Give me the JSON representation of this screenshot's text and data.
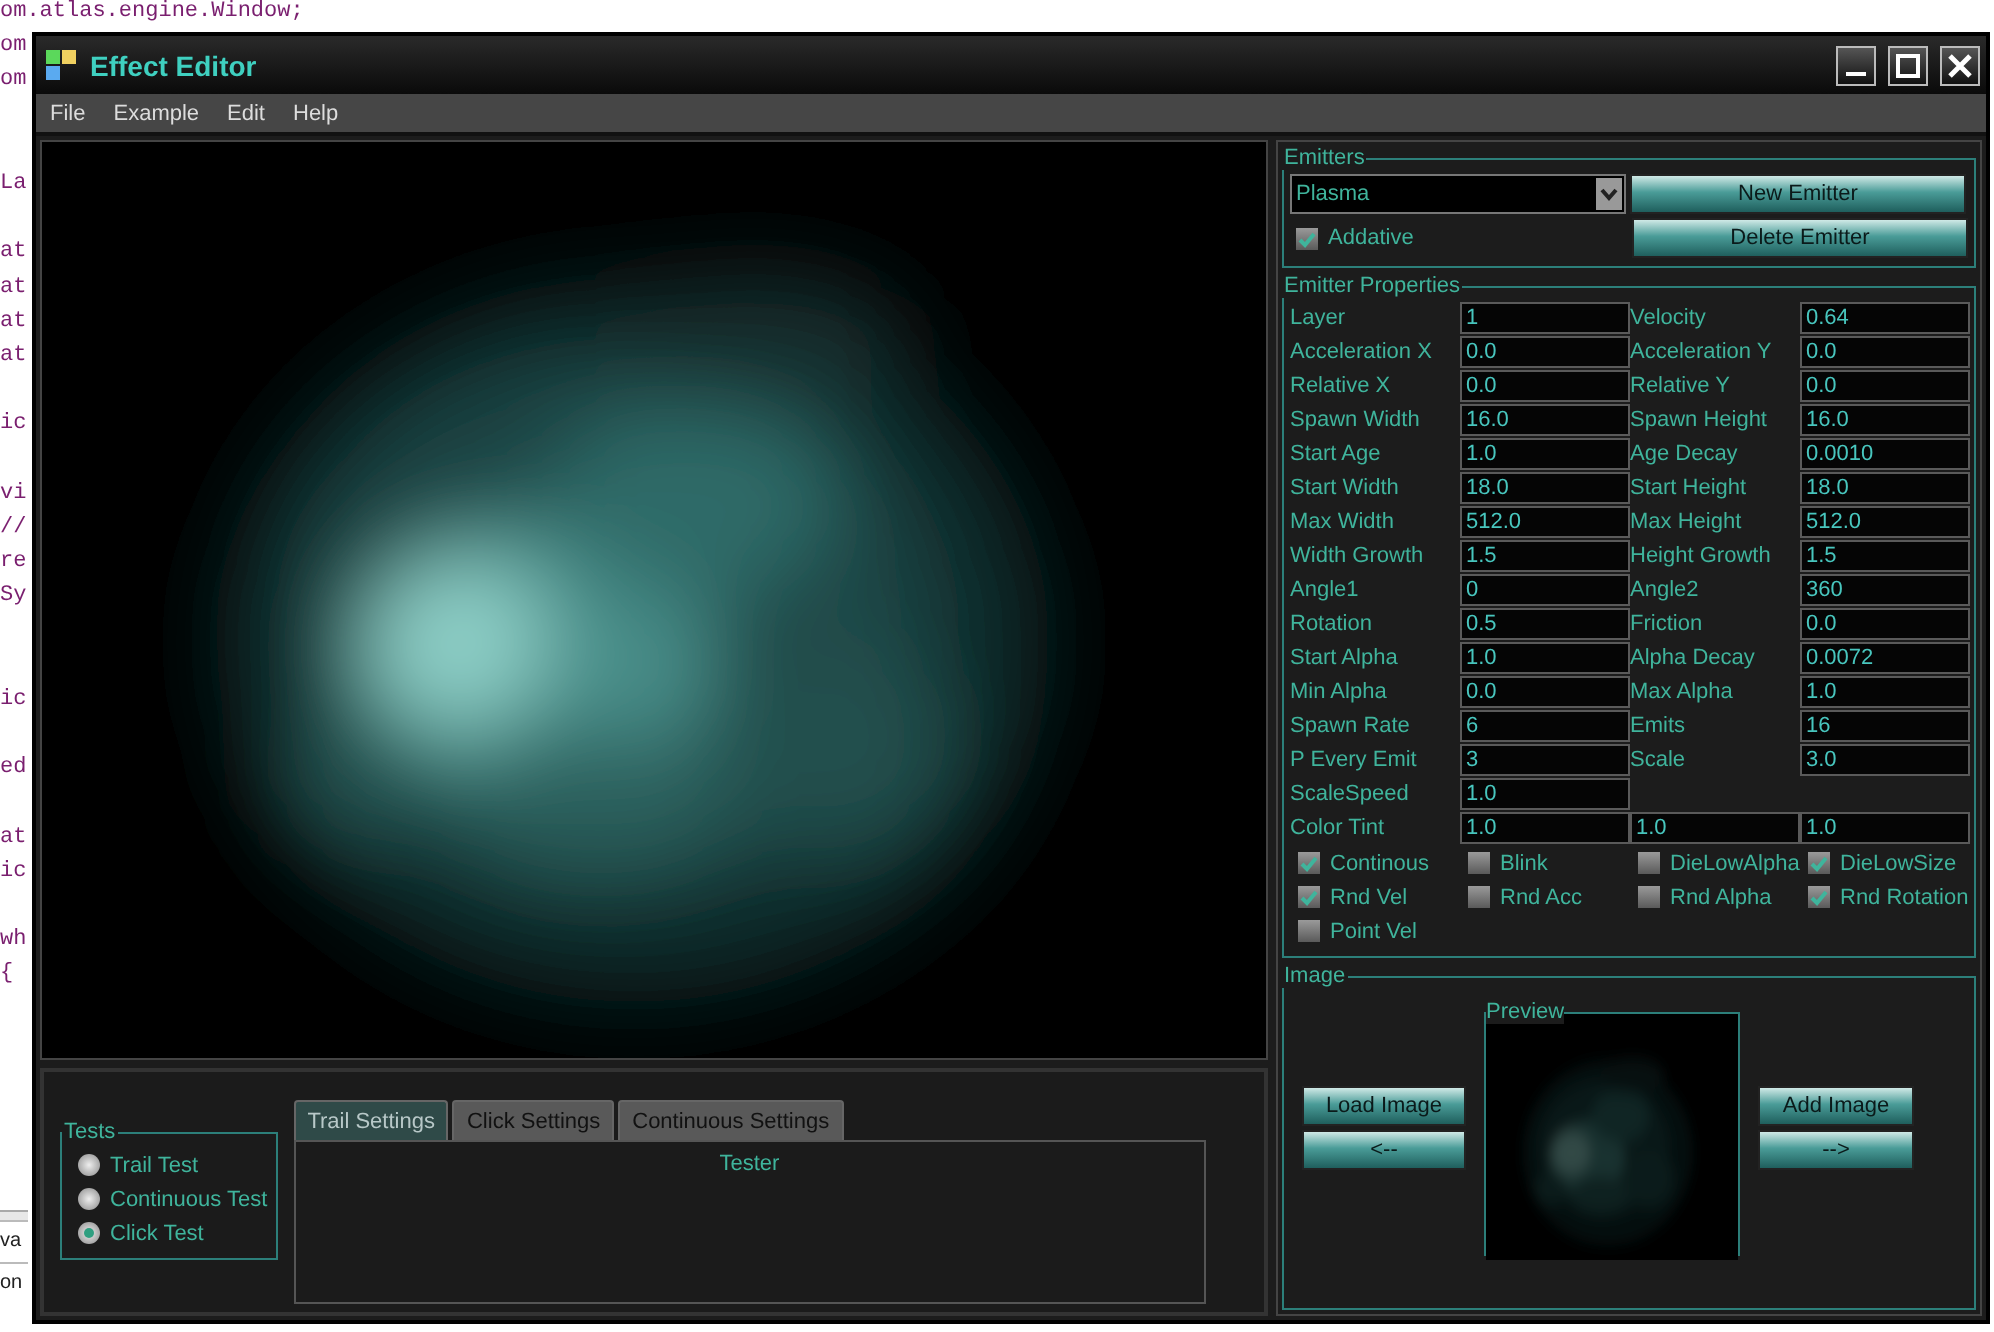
{
  "code_lines": [
    {
      "kind": "text",
      "text": "om.atlas.engine.Window;"
    },
    {
      "kind": "text",
      "text": "om"
    },
    {
      "kind": "text",
      "text": "om"
    },
    {
      "kind": "blank"
    },
    {
      "kind": "blank"
    },
    {
      "kind": "text",
      "text": "La"
    },
    {
      "kind": "blank"
    },
    {
      "kind": "text",
      "text": "at"
    },
    {
      "kind": "text",
      "text": "at"
    },
    {
      "kind": "text",
      "text": "at"
    },
    {
      "kind": "text",
      "text": "at"
    },
    {
      "kind": "blank"
    },
    {
      "kind": "text",
      "text": "ic"
    },
    {
      "kind": "blank"
    },
    {
      "kind": "text",
      "text": "vi"
    },
    {
      "kind": "text",
      "text": "//"
    },
    {
      "kind": "text",
      "text": "re"
    },
    {
      "kind": "text",
      "text": "Sy"
    },
    {
      "kind": "blank"
    },
    {
      "kind": "blank"
    },
    {
      "kind": "text",
      "text": "ic"
    },
    {
      "kind": "blank"
    },
    {
      "kind": "text",
      "text": "ed"
    },
    {
      "kind": "blank"
    },
    {
      "kind": "text",
      "text": "at"
    },
    {
      "kind": "text",
      "text": "ic"
    },
    {
      "kind": "blank"
    },
    {
      "kind": "text",
      "text": "wh"
    },
    {
      "kind": "text",
      "text": "{"
    }
  ],
  "code_status": [
    "va",
    "on"
  ],
  "window": {
    "title": "Effect Editor"
  },
  "menu": [
    "File",
    "Example",
    "Edit",
    "Help"
  ],
  "emitters": {
    "legend": "Emitters",
    "selected_emitter": "Plasma",
    "additive": {
      "label": "Addative",
      "checked": true
    },
    "buttons": [
      "New Emitter",
      "Delete Emitter"
    ]
  },
  "emitter_properties": {
    "legend": "Emitter Properties",
    "rows": [
      [
        {
          "label": "Layer",
          "value": "1"
        },
        {
          "label": "Velocity",
          "value": "0.64"
        }
      ],
      [
        {
          "label": "Acceleration X",
          "value": "0.0"
        },
        {
          "label": "Acceleration Y",
          "value": "0.0"
        }
      ],
      [
        {
          "label": "Relative X",
          "value": "0.0"
        },
        {
          "label": "Relative Y",
          "value": "0.0"
        }
      ],
      [
        {
          "label": "Spawn Width",
          "value": "16.0"
        },
        {
          "label": "Spawn Height",
          "value": "16.0"
        }
      ],
      [
        {
          "label": "Start Age",
          "value": "1.0"
        },
        {
          "label": "Age Decay",
          "value": "0.0010"
        }
      ],
      [
        {
          "label": "Start Width",
          "value": "18.0"
        },
        {
          "label": "Start Height",
          "value": "18.0"
        }
      ],
      [
        {
          "label": "Max Width",
          "value": "512.0"
        },
        {
          "label": "Max Height",
          "value": "512.0"
        }
      ],
      [
        {
          "label": "Width Growth",
          "value": "1.5"
        },
        {
          "label": "Height Growth",
          "value": "1.5"
        }
      ],
      [
        {
          "label": "Angle1",
          "value": "0"
        },
        {
          "label": "Angle2",
          "value": "360"
        }
      ],
      [
        {
          "label": "Rotation",
          "value": "0.5"
        },
        {
          "label": "Friction",
          "value": "0.0"
        }
      ],
      [
        {
          "label": "Start Alpha",
          "value": "1.0"
        },
        {
          "label": "Alpha Decay",
          "value": "0.0072"
        }
      ],
      [
        {
          "label": "Min Alpha",
          "value": "0.0"
        },
        {
          "label": "Max Alpha",
          "value": "1.0"
        }
      ],
      [
        {
          "label": "Spawn Rate",
          "value": "6"
        },
        {
          "label": "Emits",
          "value": "16"
        }
      ],
      [
        {
          "label": "P Every Emit",
          "value": "3"
        },
        {
          "label": "Scale",
          "value": "3.0"
        }
      ],
      [
        {
          "label": "ScaleSpeed",
          "value": "1.0"
        }
      ]
    ],
    "color_tint": {
      "label": "Color Tint",
      "values": [
        "1.0",
        "1.0",
        "1.0"
      ]
    },
    "checkboxes": [
      {
        "label": "Continous",
        "checked": true
      },
      {
        "label": "Blink",
        "checked": false
      },
      {
        "label": "DieLowAlpha",
        "checked": false
      },
      {
        "label": "DieLowSize",
        "checked": true
      },
      {
        "label": "Rnd Vel",
        "checked": true
      },
      {
        "label": "Rnd Acc",
        "checked": false
      },
      {
        "label": "Rnd Alpha",
        "checked": false
      },
      {
        "label": "Rnd Rotation",
        "checked": true
      },
      {
        "label": "Point Vel",
        "checked": false
      }
    ]
  },
  "image": {
    "legend": "Image",
    "preview_legend": "Preview",
    "left_buttons": [
      "Load Image",
      "<--"
    ],
    "right_buttons": [
      "Add Image",
      "-->"
    ]
  },
  "tests": {
    "legend": "Tests",
    "options": [
      {
        "label": "Trail Test",
        "selected": false
      },
      {
        "label": "Continuous Test",
        "selected": false
      },
      {
        "label": "Click Test",
        "selected": true
      }
    ]
  },
  "settings_tabs": [
    {
      "label": "Trail Settings",
      "selected": true
    },
    {
      "label": "Click Settings",
      "selected": false
    },
    {
      "label": "Continuous Settings",
      "selected": false
    }
  ],
  "tab_content": {
    "title": "Tester"
  }
}
